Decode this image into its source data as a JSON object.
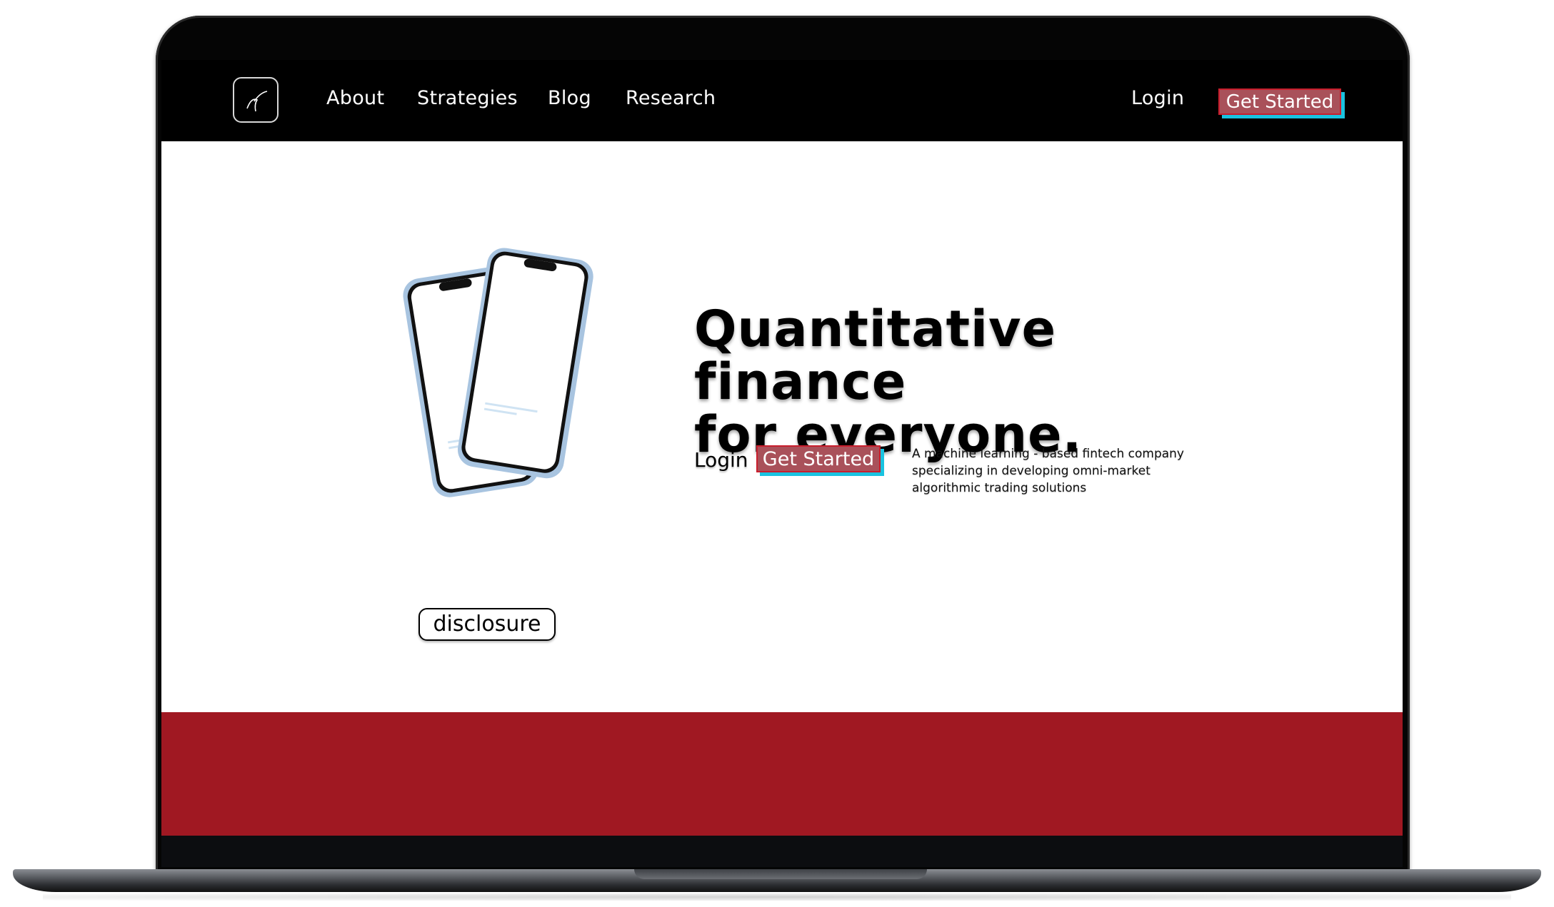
{
  "nav": {
    "links": [
      "About",
      "Strategies",
      "Blog",
      "Research"
    ],
    "login": "Login",
    "get_started": "Get Started"
  },
  "hero": {
    "title_line1": "Quantitative finance",
    "title_line2": "for everyone.",
    "login": "Login",
    "get_started": "Get Started",
    "tagline_line1": "A machine learning - based fintech company",
    "tagline_line2": "specializing in developing omni-market",
    "tagline_line3": "algorithmic trading solutions",
    "disclosure": "disclosure"
  },
  "colors": {
    "nav_background": "#000000",
    "button_fill": "#a9515a",
    "button_shadow": "#19c3e0",
    "band": "#a01822"
  },
  "icons": [
    "logo-mark-icon",
    "phone-mockup-image"
  ]
}
